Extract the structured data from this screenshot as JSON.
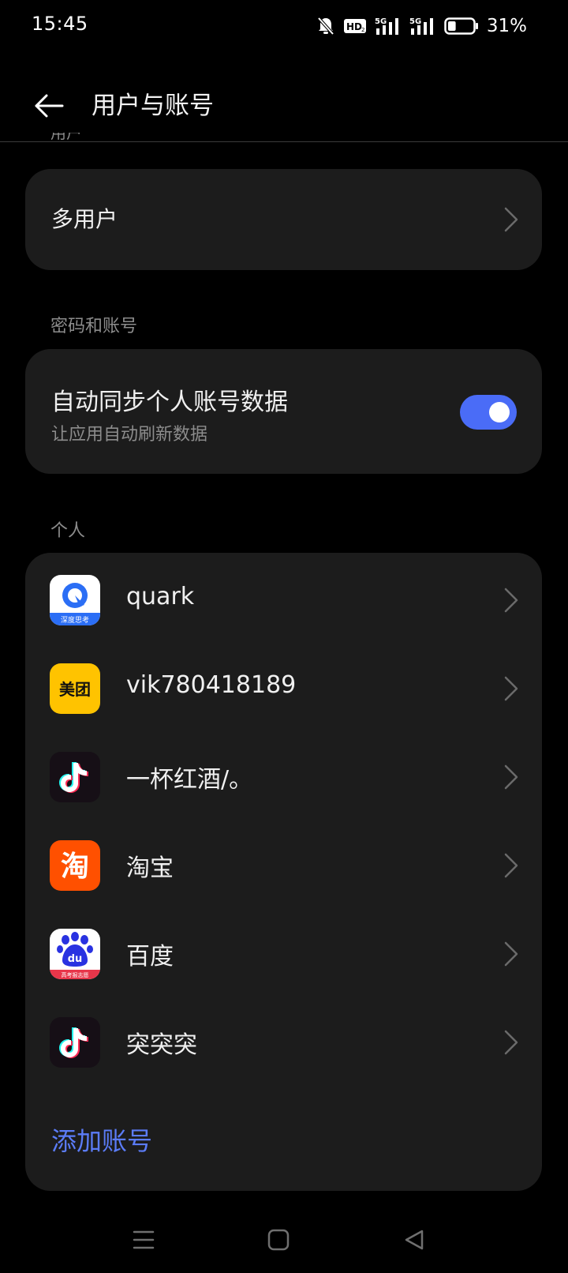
{
  "status_bar": {
    "time": "15:45",
    "battery_percent": "31%",
    "battery_level": 0.31,
    "icons": [
      "bell-off-icon",
      "hd-icon",
      "signal-5g-icon",
      "signal-5g-icon",
      "battery-icon"
    ]
  },
  "app_bar": {
    "title": "用户与账号",
    "back_icon": "arrow-left-icon"
  },
  "sections": {
    "users": {
      "partial_header": "用户",
      "multi_user_label": "多用户"
    },
    "password_accounts": {
      "header": "密码和账号",
      "sync_title": "自动同步个人账号数据",
      "sync_subtitle": "让应用自动刷新数据",
      "sync_enabled": true
    },
    "personal": {
      "header": "个人",
      "accounts": [
        {
          "name": "quark",
          "icon": "quark-icon",
          "badge": "深度思考"
        },
        {
          "name": "vik780418189",
          "icon": "meituan-icon",
          "badge": "美团"
        },
        {
          "name": "一杯红酒/。",
          "icon": "douyin-icon",
          "badge": ""
        },
        {
          "name": "淘宝",
          "icon": "taobao-icon",
          "badge": "淘"
        },
        {
          "name": "百度",
          "icon": "baidu-icon",
          "badge": "高考报志愿"
        },
        {
          "name": "突突突",
          "icon": "douyin-icon",
          "badge": ""
        }
      ],
      "add_account": "添加账号"
    }
  },
  "colors": {
    "background": "#000000",
    "card": "#1c1c1c",
    "accent": "#4a6cf7",
    "link": "#5b7cf7",
    "secondary_text": "#8c8c8c"
  },
  "nav_bar": {
    "icons": [
      "menu-icon",
      "home-square-icon",
      "back-triangle-icon"
    ]
  }
}
